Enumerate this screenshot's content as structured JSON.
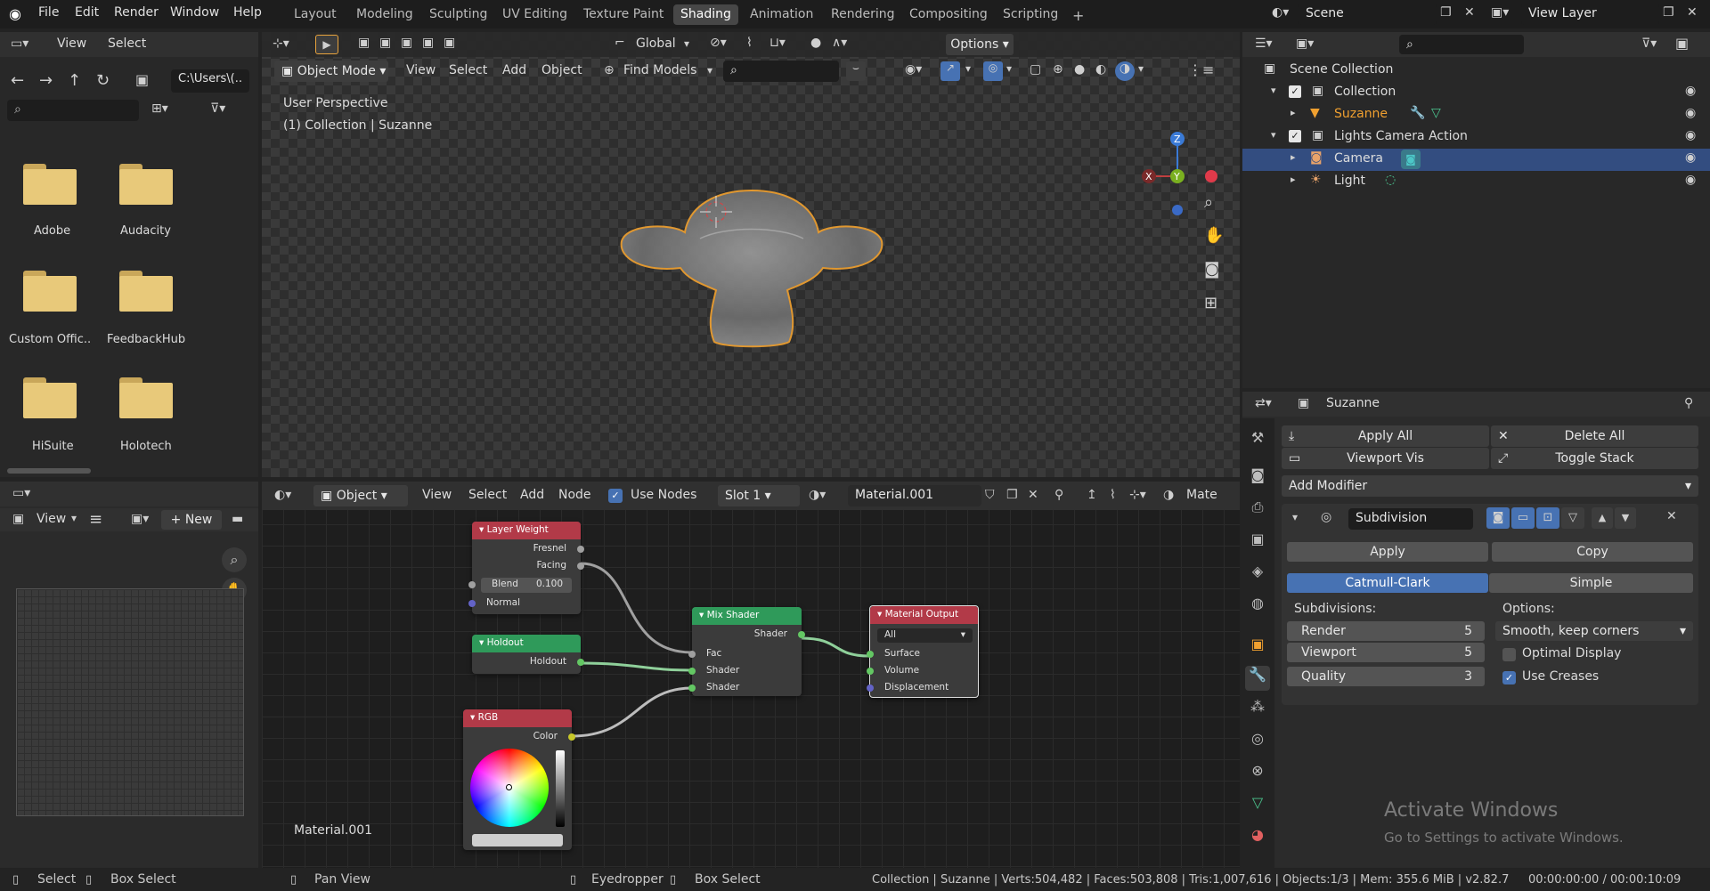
{
  "topbar": {
    "menus": [
      "File",
      "Edit",
      "Render",
      "Window",
      "Help"
    ],
    "workspaces": [
      "Layout",
      "Modeling",
      "Sculpting",
      "UV Editing",
      "Texture Paint",
      "Shading",
      "Animation",
      "Rendering",
      "Compositing",
      "Scripting"
    ],
    "active_workspace": "Shading",
    "plus": "+",
    "scene": "Scene",
    "view_layer": "View Layer"
  },
  "filebrowser": {
    "view": "View",
    "select": "Select",
    "path": "C:\\Users\\(..",
    "items": [
      "Adobe",
      "Audacity",
      "Custom Offic..",
      "FeedbackHub",
      "HiSuite",
      "Holotech"
    ]
  },
  "imageeditor": {
    "view": "View",
    "new": "New"
  },
  "viewport": {
    "orientation": "Global",
    "options": "Options",
    "mode": "Object Mode",
    "menus": [
      "View",
      "Select",
      "Add",
      "Object"
    ],
    "find_models": "Find Models",
    "perspective": "User Perspective",
    "collection_info": "(1) Collection | Suzanne",
    "gizmo": {
      "x": "X",
      "y": "Y",
      "z": "Z"
    }
  },
  "nodeeditor": {
    "type": "Object",
    "menus": [
      "View",
      "Select",
      "Add",
      "Node"
    ],
    "use_nodes": "Use Nodes",
    "slot": "Slot 1",
    "material": "Material.001",
    "mate_clip": "Mate",
    "material_label": "Material.001",
    "nodes": {
      "layer_weight": {
        "title": "Layer Weight",
        "out1": "Fresnel",
        "out2": "Facing",
        "blend_label": "Blend",
        "blend_value": "0.100",
        "normal": "Normal"
      },
      "holdout": {
        "title": "Holdout",
        "out": "Holdout"
      },
      "rgb": {
        "title": "RGB",
        "out": "Color"
      },
      "mix_shader": {
        "title": "Mix Shader",
        "out": "Shader",
        "in1": "Fac",
        "in2": "Shader",
        "in3": "Shader"
      },
      "material_output": {
        "title": "Material Output",
        "target": "All",
        "in1": "Surface",
        "in2": "Volume",
        "in3": "Displacement"
      }
    }
  },
  "outliner": {
    "rows": [
      {
        "label": "Scene Collection"
      },
      {
        "label": "Collection"
      },
      {
        "label": "Suzanne"
      },
      {
        "label": "Lights Camera Action"
      },
      {
        "label": "Camera"
      },
      {
        "label": "Light"
      }
    ]
  },
  "properties": {
    "object": "Suzanne",
    "apply_all": "Apply All",
    "delete_all": "Delete All",
    "viewport_vis": "Viewport Vis",
    "toggle_stack": "Toggle Stack",
    "add_modifier": "Add Modifier",
    "modifier_name": "Subdivision",
    "apply": "Apply",
    "copy": "Copy",
    "catmull": "Catmull-Clark",
    "simple": "Simple",
    "subdivisions": "Subdivisions:",
    "options": "Options:",
    "render_label": "Render",
    "render_value": "5",
    "viewport_label": "Viewport",
    "viewport_value": "5",
    "quality_label": "Quality",
    "quality_value": "3",
    "smooth": "Smooth, keep corners",
    "optimal": "Optimal Display",
    "creases": "Use Creases",
    "watermark_title": "Activate Windows",
    "watermark_sub": "Go to Settings to activate Windows."
  },
  "statusbar": {
    "select": "Select",
    "box_select": "Box Select",
    "pan_view": "Pan View",
    "eyedropper": "Eyedropper",
    "box_select2": "Box Select",
    "stats": "Collection | Suzanne | Verts:504,482 | Faces:503,808 | Tris:1,007,616 | Objects:1/3 | Mem: 355.6 MiB | v2.82.7",
    "time": "00:00:00:00 / 00:00:10:09"
  }
}
